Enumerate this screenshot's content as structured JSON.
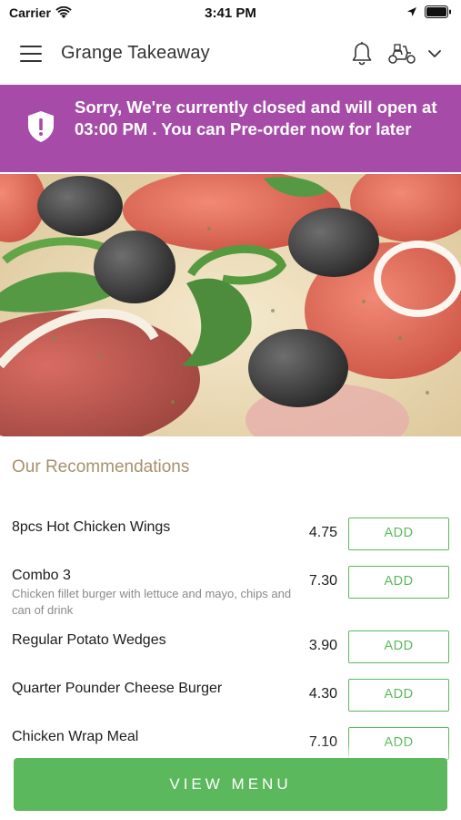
{
  "status_bar": {
    "carrier": "Carrier",
    "time": "3:41 PM"
  },
  "navbar": {
    "title": "Grange Takeaway",
    "icons": [
      "menu-icon",
      "bell-icon",
      "scooter-icon",
      "chevron-down-icon"
    ]
  },
  "banner": {
    "message": "Sorry, We're currently closed and will open at 03:00 PM . You can Pre-order now for later",
    "icon": "shield-alert-icon",
    "color": "#a64ca8"
  },
  "recommendations": {
    "title": "Our Recommendations",
    "items": [
      {
        "name": "8pcs Hot Chicken Wings",
        "description": "",
        "price": "4.75",
        "button": "ADD"
      },
      {
        "name": "Combo 3",
        "description": "Chicken fillet burger with lettuce and mayo, chips and can of drink",
        "price": "7.30",
        "button": "ADD"
      },
      {
        "name": "Regular Potato Wedges",
        "description": "",
        "price": "3.90",
        "button": "ADD"
      },
      {
        "name": "Quarter Pounder Cheese Burger",
        "description": "",
        "price": "4.30",
        "button": "ADD"
      },
      {
        "name": "Chicken Wrap Meal",
        "description": "",
        "price": "7.10",
        "button": "ADD"
      }
    ]
  },
  "footer": {
    "view_menu_label": "VIEW MENU",
    "accent": "#5cb85c"
  }
}
